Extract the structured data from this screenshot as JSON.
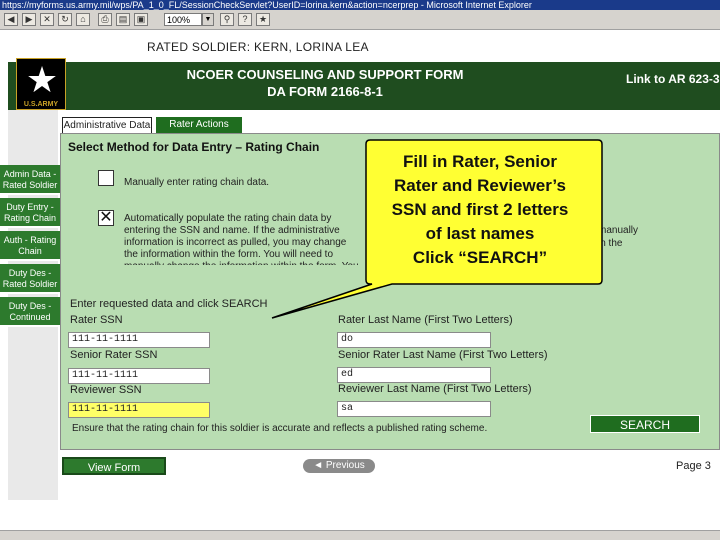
{
  "browser": {
    "title": "https://myforms.us.army.mil/wps/PA_1_0_FL/SessionCheckServlet?UserID=lorina.kern&action=ncerprep - Microsoft Internet Explorer",
    "zoom": "100%"
  },
  "rated_soldier": "RATED SOLDIER:  KERN, LORINA LEA",
  "header": {
    "logo_text": "U.S.ARMY",
    "title_line1": "NCOER COUNSELING AND SUPPORT FORM",
    "title_line2": "DA FORM 2166-8-1",
    "link": "Link to AR 623-3"
  },
  "tabs": [
    {
      "label": "Administrative Data"
    },
    {
      "label": "Rater Actions"
    }
  ],
  "nav": [
    {
      "label": "Admin Data - Rated Soldier"
    },
    {
      "label": "Duty Entry - Rating Chain"
    },
    {
      "label": "Auth - Rating Chain"
    },
    {
      "label": "Duty Des - Rated Soldier"
    },
    {
      "label": "Duty Des - Continued"
    }
  ],
  "section": {
    "title": "Select Method for Data Entry – Rating Chain",
    "option_manual": "Manually enter rating chain data.",
    "option_auto": "Automatically populate the rating chain data by entering the SSN and name. If the administrative information is incorrect as pulled, you may change the information within the form. You will need to manually change the information within the form. You will need to manually correct the information in the incorrect information changed.",
    "option_auto_right": "manually",
    "option_auto_right2": "in the",
    "enter_prompt": "Enter requested data and click SEARCH"
  },
  "fields": {
    "rater_ssn_label": "Rater SSN",
    "rater_ssn_value": "111-11-1111",
    "rater_last_label": "Rater Last Name (First Two Letters)",
    "rater_last_value": "do",
    "senior_ssn_label": "Senior Rater SSN",
    "senior_ssn_value": "111-11-1111",
    "senior_last_label": "Senior Rater Last Name (First Two Letters)",
    "senior_last_value": "ed",
    "reviewer_ssn_label": "Reviewer SSN",
    "reviewer_ssn_value": "111-11-1111",
    "reviewer_last_label": "Reviewer Last Name (First Two Letters)",
    "reviewer_last_value": "sa"
  },
  "search_label": "SEARCH",
  "ensure_text": "Ensure that the rating chain for this soldier is accurate and reflects a published rating scheme.",
  "footer": {
    "view_form": "View Form",
    "previous": "◄ Previous",
    "page": "Page 3"
  },
  "callout": {
    "line1": "Fill in Rater, Senior",
    "line2": "Rater and Reviewer’s",
    "line3": "SSN and first 2 letters",
    "line4": "of last names",
    "line5": "Click “SEARCH”"
  },
  "colors": {
    "header_green": "#1f4d1f",
    "nav_green": "#2d7a2d",
    "panel_green": "#b9ddb2",
    "callout_yellow": "#ffff33",
    "field_highlight": "#ffff66"
  }
}
